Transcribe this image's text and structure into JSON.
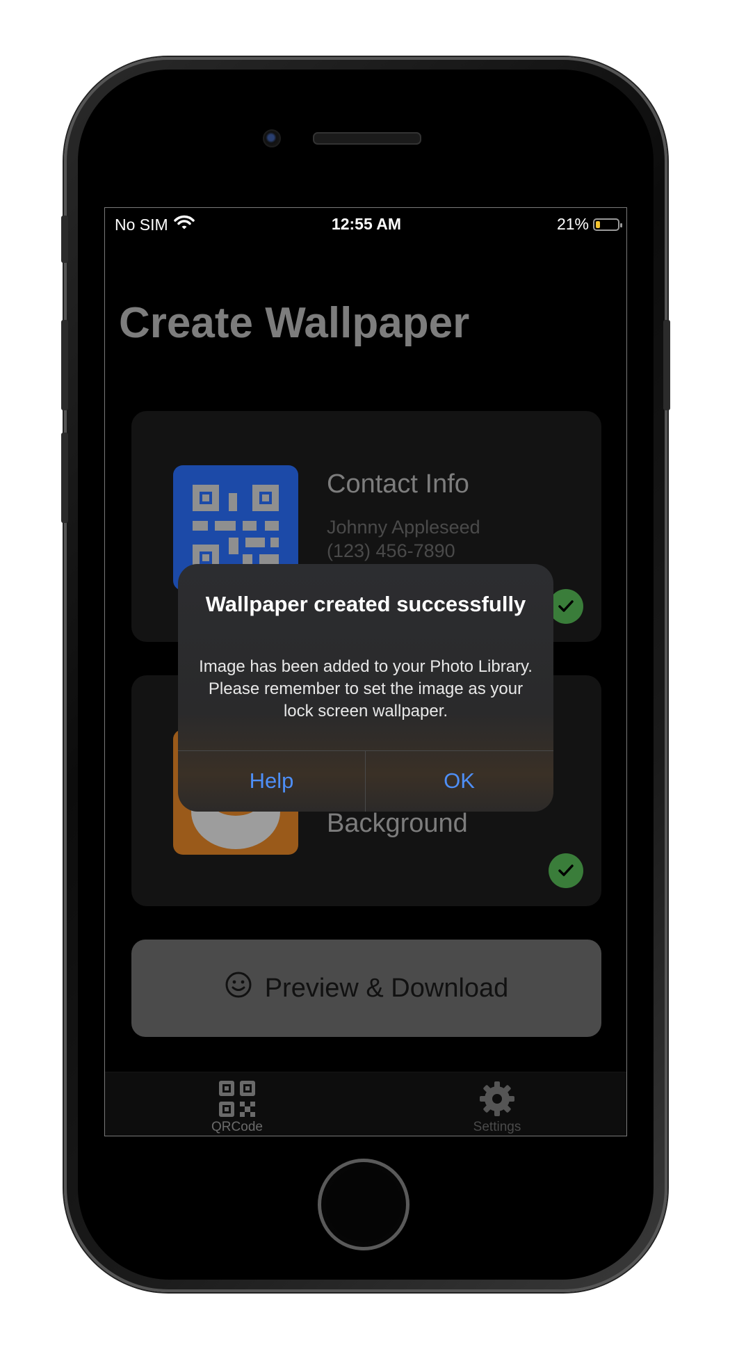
{
  "status_bar": {
    "carrier": "No SIM",
    "time": "12:55 AM",
    "battery_percent": "21%",
    "battery_level": 0.21
  },
  "page": {
    "title": "Create Wallpaper"
  },
  "cards": [
    {
      "title": "Contact Info",
      "lines": [
        "Johnny Appleseed",
        "(123) 456-7890"
      ],
      "icon": "qr-code-icon",
      "icon_color": "#1c4aa8",
      "checked": true
    },
    {
      "title": "Background",
      "icon": "background-image-icon",
      "icon_color": "#9a5a1a",
      "checked": true
    }
  ],
  "preview_button": {
    "label": "Preview & Download",
    "icon": "smiley-icon"
  },
  "tabs": [
    {
      "label": "QRCode",
      "icon": "qr-code-icon"
    },
    {
      "label": "Settings",
      "icon": "gear-icon"
    }
  ],
  "alert": {
    "title": "Wallpaper created successfully",
    "message": "Image has been added to your Photo Library. Please remember to set the image as your lock screen wallpaper.",
    "buttons": [
      "Help",
      "OK"
    ],
    "button_color": "#4e8ff7"
  }
}
